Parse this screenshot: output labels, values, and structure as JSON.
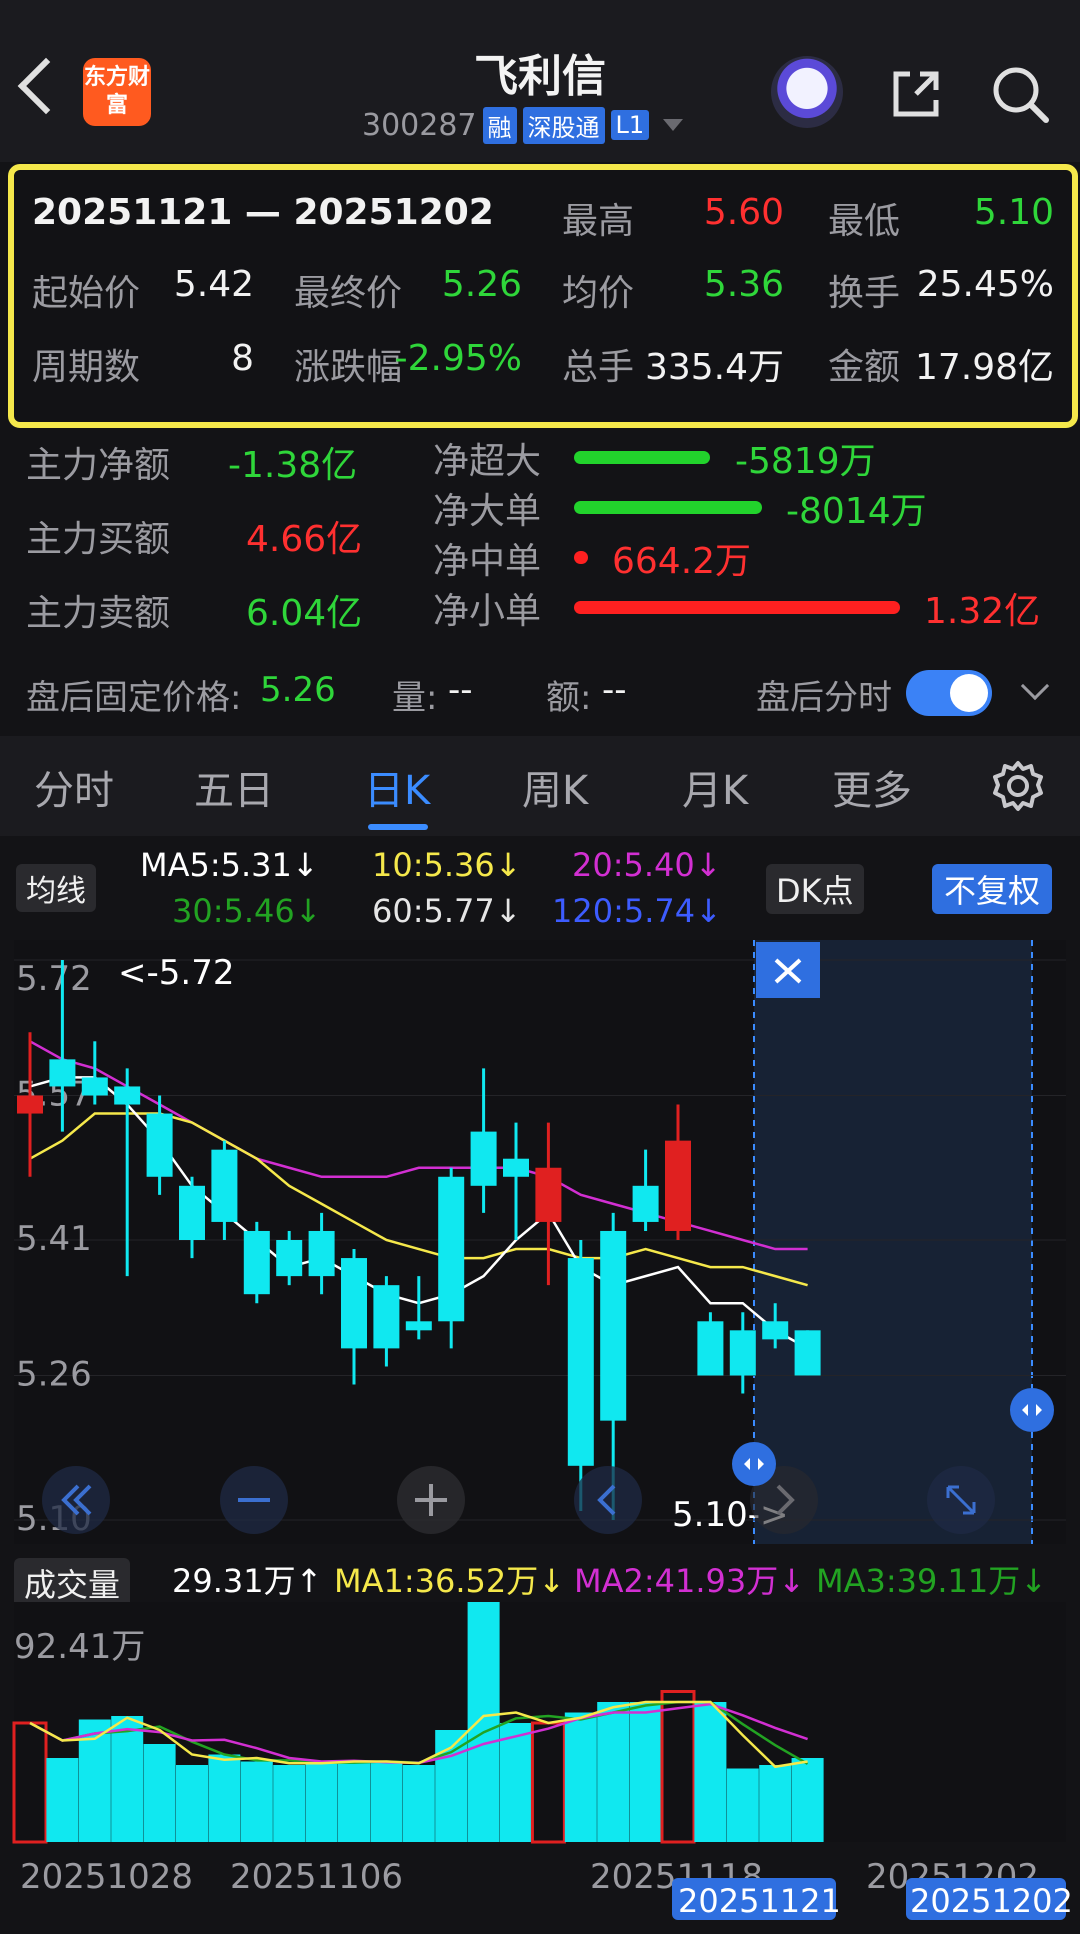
{
  "header": {
    "title": "飞利信",
    "code": "300287",
    "tags": [
      "融",
      "深股通",
      "L1"
    ],
    "logo_text": "东方财富"
  },
  "summary": {
    "range": "20251121 — 20251202",
    "high_label": "最高",
    "high": "5.60",
    "low_label": "最低",
    "low": "5.10",
    "open_label": "起始价",
    "open": "5.42",
    "close_label": "最终价",
    "close": "5.26",
    "avg_label": "均价",
    "avg": "5.36",
    "turnover_label": "换手",
    "turnover": "25.45%",
    "periods_label": "周期数",
    "periods": "8",
    "change_label": "涨跌幅",
    "change": "-2.95%",
    "volume_label": "总手",
    "volume": "335.4万",
    "amount_label": "金额",
    "amount": "17.98亿"
  },
  "fund_flow": {
    "main_net_label": "主力净额",
    "main_net": "-1.38亿",
    "main_buy_label": "主力买额",
    "main_buy": "4.66亿",
    "main_sell_label": "主力卖额",
    "main_sell": "6.04亿",
    "rows": [
      {
        "label": "净超大",
        "value": "-5819万",
        "color": "#22d32c",
        "fraction": 0.44
      },
      {
        "label": "净大单",
        "value": "-8014万",
        "color": "#22d32c",
        "fraction": 0.61
      },
      {
        "label": "净中单",
        "value": "664.2万",
        "color": "#ff2020",
        "fraction": 0.05
      },
      {
        "label": "净小单",
        "value": "1.32亿",
        "color": "#ff2020",
        "fraction": 1.0
      }
    ]
  },
  "after_hours": {
    "fixed_price_label": "盘后固定价格:",
    "fixed_price": "5.26",
    "vol_label": "量:",
    "vol": "--",
    "amt_label": "额:",
    "amt": "--",
    "intraday_label": "盘后分时"
  },
  "tabs": [
    "分时",
    "五日",
    "日K",
    "周K",
    "月K",
    "更多"
  ],
  "active_tab": "日K",
  "ma_legend": {
    "selector": "均线",
    "ma5": "MA5:5.31↓",
    "ma10": "10:5.36↓",
    "ma20": "20:5.40↓",
    "ma30": "30:5.46↓",
    "ma60": "60:5.77↓",
    "ma120": "120:5.74↓",
    "dk_button": "DK点",
    "adjust_button": "不复权"
  },
  "colors": {
    "up": "#e02020",
    "down": "#10e8f0",
    "ma5": "#ffffff",
    "ma10": "#f5e84b",
    "ma20": "#d22fd2",
    "ma30": "#22a322",
    "highlight": "#f5e84b",
    "accent": "#3b8cff"
  },
  "chart_data": [
    {
      "type": "candlestick",
      "y_ticks": [
        "5.72",
        "5.57",
        "5.41",
        "5.26",
        "5.10"
      ],
      "ylim": [
        5.1,
        5.72
      ],
      "max_label": "<-5.72",
      "min_label": "5.10->",
      "candles": [
        {
          "o": 5.55,
          "c": 5.57,
          "h": 5.64,
          "l": 5.48
        },
        {
          "o": 5.61,
          "c": 5.58,
          "h": 5.72,
          "l": 5.53
        },
        {
          "o": 5.59,
          "c": 5.57,
          "h": 5.63,
          "l": 5.56
        },
        {
          "o": 5.58,
          "c": 5.56,
          "h": 5.6,
          "l": 5.37
        },
        {
          "o": 5.55,
          "c": 5.48,
          "h": 5.57,
          "l": 5.46
        },
        {
          "o": 5.47,
          "c": 5.41,
          "h": 5.48,
          "l": 5.39
        },
        {
          "o": 5.51,
          "c": 5.43,
          "h": 5.52,
          "l": 5.41
        },
        {
          "o": 5.42,
          "c": 5.35,
          "h": 5.43,
          "l": 5.34
        },
        {
          "o": 5.41,
          "c": 5.37,
          "h": 5.42,
          "l": 5.36
        },
        {
          "o": 5.42,
          "c": 5.37,
          "h": 5.44,
          "l": 5.35
        },
        {
          "o": 5.39,
          "c": 5.29,
          "h": 5.4,
          "l": 5.25
        },
        {
          "o": 5.36,
          "c": 5.29,
          "h": 5.37,
          "l": 5.27
        },
        {
          "o": 5.32,
          "c": 5.31,
          "h": 5.37,
          "l": 5.3
        },
        {
          "o": 5.48,
          "c": 5.32,
          "h": 5.49,
          "l": 5.29
        },
        {
          "o": 5.53,
          "c": 5.47,
          "h": 5.6,
          "l": 5.44
        },
        {
          "o": 5.5,
          "c": 5.48,
          "h": 5.54,
          "l": 5.41
        },
        {
          "o": 5.43,
          "c": 5.49,
          "h": 5.54,
          "l": 5.36
        },
        {
          "o": 5.39,
          "c": 5.16,
          "h": 5.41,
          "l": 5.11
        },
        {
          "o": 5.42,
          "c": 5.21,
          "h": 5.44,
          "l": 5.1
        },
        {
          "o": 5.47,
          "c": 5.43,
          "h": 5.51,
          "l": 5.42
        },
        {
          "o": 5.42,
          "c": 5.52,
          "h": 5.56,
          "l": 5.41
        },
        {
          "o": 5.32,
          "c": 5.26,
          "h": 5.33,
          "l": 5.26
        },
        {
          "o": 5.31,
          "c": 5.26,
          "h": 5.33,
          "l": 5.24
        },
        {
          "o": 5.32,
          "c": 5.3,
          "h": 5.34,
          "l": 5.29
        },
        {
          "o": 5.31,
          "c": 5.26,
          "h": 5.31,
          "l": 5.26
        }
      ],
      "ma5": [
        5.58,
        5.59,
        5.59,
        5.56,
        5.52,
        5.47,
        5.44,
        5.41,
        5.38,
        5.39,
        5.37,
        5.35,
        5.34,
        5.35,
        5.37,
        5.41,
        5.44,
        5.38,
        5.36,
        5.37,
        5.38,
        5.34,
        5.34,
        5.31,
        5.29
      ],
      "ma10": [
        5.5,
        5.52,
        5.55,
        5.55,
        5.55,
        5.54,
        5.52,
        5.5,
        5.47,
        5.45,
        5.43,
        5.41,
        5.4,
        5.39,
        5.39,
        5.4,
        5.4,
        5.39,
        5.39,
        5.4,
        5.39,
        5.38,
        5.38,
        5.37,
        5.36
      ],
      "ma20": [
        5.63,
        5.61,
        5.6,
        5.58,
        5.56,
        5.54,
        5.52,
        5.5,
        5.49,
        5.48,
        5.48,
        5.48,
        5.49,
        5.49,
        5.49,
        5.49,
        5.48,
        5.46,
        5.45,
        5.44,
        5.43,
        5.42,
        5.41,
        5.4,
        5.4
      ]
    },
    {
      "type": "bar",
      "ylabel_max": "92.41万",
      "x_ticks": [
        "20251028",
        "20251106",
        "20251118",
        "20251121",
        "20251202"
      ],
      "legend": {
        "label": "成交量",
        "vol": "29.31万↑",
        "ma1": "MA1:36.52万↓",
        "ma2": "MA2:41.93万↓",
        "ma3": "MA3:39.11万↓"
      },
      "values": [
        34,
        24,
        35,
        36,
        28,
        22,
        25,
        23,
        22,
        23,
        23,
        23,
        22,
        32,
        92,
        34,
        34,
        37,
        40,
        40,
        43,
        40,
        21,
        22,
        24
      ]
    }
  ]
}
